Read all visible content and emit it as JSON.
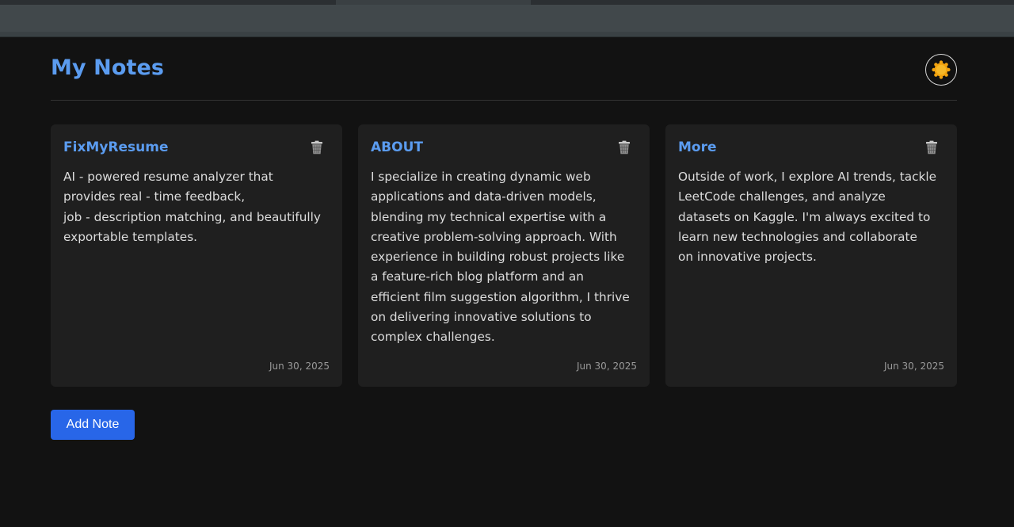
{
  "header": {
    "title": "My Notes",
    "theme_toggle_icon": "sun-icon"
  },
  "notes": [
    {
      "title": "FixMyResume",
      "body": "AI - powered resume analyzer that\nprovides real - time feedback,\njob - description matching, and beautifully\nexportable templates.",
      "date": "Jun 30, 2025",
      "delete_icon": "trash-icon"
    },
    {
      "title": "ABOUT",
      "body": "I specialize in creating dynamic web\napplications and data-driven models,\nblending my technical expertise with a\ncreative problem-solving approach. With\nexperience in building robust projects like\na feature-rich blog platform and an\nefficient film suggestion algorithm, I thrive\non delivering innovative solutions to\ncomplex challenges.",
      "date": "Jun 30, 2025",
      "delete_icon": "trash-icon"
    },
    {
      "title": "More",
      "body": "Outside of work, I explore AI trends, tackle\nLeetCode challenges, and analyze\ndatasets on Kaggle. I'm always excited to\nlearn new technologies and collaborate\non innovative projects.",
      "date": "Jun 30, 2025",
      "delete_icon": "trash-icon"
    }
  ],
  "actions": {
    "add_note_label": "Add Note"
  },
  "colors": {
    "background": "#121212",
    "card": "#1f1f1f",
    "accent": "#5b9cf0",
    "button": "#2866e8"
  }
}
